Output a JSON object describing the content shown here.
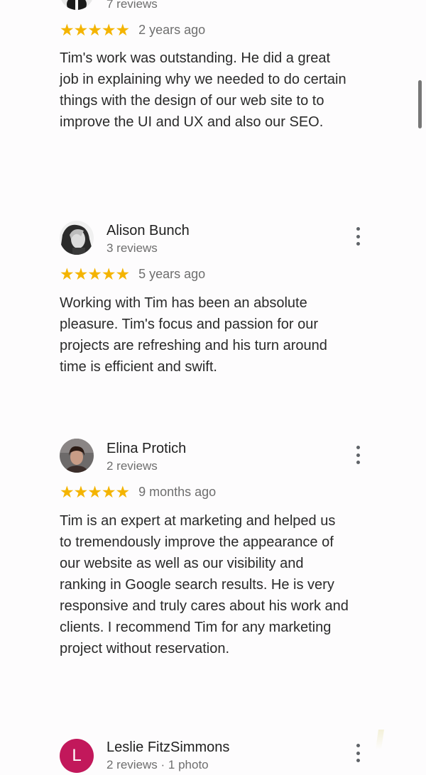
{
  "reviews": [
    {
      "reviewer": "",
      "review_count": "7 reviews",
      "stars": "★★★★★",
      "date": "2 years ago",
      "text": "Tim's work was outstanding. He did a great job in explaining why we needed to do certain things with the design of our web site to to improve the UI and UX and also our SEO."
    },
    {
      "reviewer": "Alison Bunch",
      "review_count": "3 reviews",
      "stars": "★★★★★",
      "date": "5 years ago",
      "text": "Working with Tim has been an absolute pleasure.  Tim's focus and passion for our projects are refreshing and his turn around time is efficient and swift."
    },
    {
      "reviewer": "Elina Protich",
      "review_count": "2 reviews",
      "stars": "★★★★★",
      "date": "9 months ago",
      "text": "Tim is an expert at marketing and helped us to tremendously improve the appearance of our website as well as our visibility and ranking in Google search results. He is very responsive and truly cares about his work and clients. I recommend Tim for any marketing project without reservation."
    },
    {
      "reviewer": "Leslie FitzSimmons",
      "avatar_letter": "L",
      "review_count": "2 reviews · 1 photo",
      "stars": "★★★★★",
      "date": "",
      "text": ""
    }
  ],
  "colors": {
    "star": "#f4b400",
    "avatar_letter_bg": "#c2185b",
    "background": "#fdfcfd"
  },
  "icons": {
    "more_menu": "more-vertical-icon",
    "rating": "star-icon"
  }
}
